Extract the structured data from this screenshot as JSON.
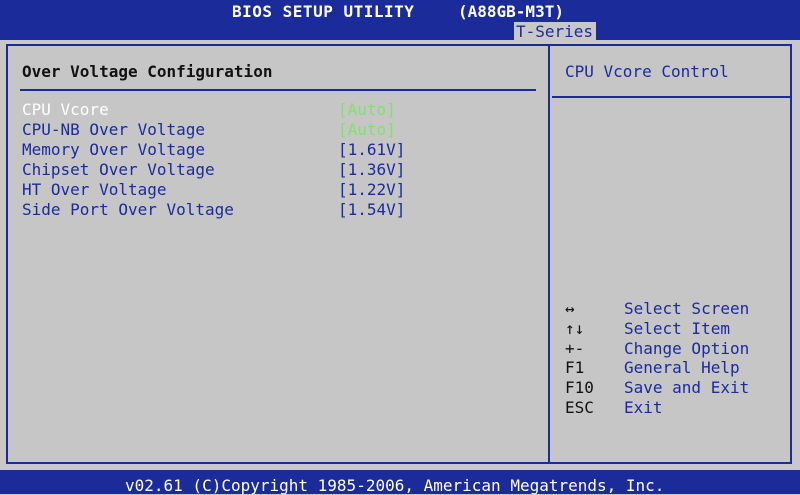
{
  "header": {
    "title": "BIOS SETUP UTILITY",
    "model": "(A88GB-M3T)",
    "tab": "T-Series"
  },
  "main": {
    "section_title": "Over Voltage Configuration",
    "items": [
      {
        "label": "CPU Vcore",
        "value": "[Auto]"
      },
      {
        "label": "CPU-NB Over Voltage",
        "value": "[Auto]"
      },
      {
        "label": "Memory Over Voltage",
        "value": "[1.61V]"
      },
      {
        "label": "Chipset Over Voltage",
        "value": "[1.36V]"
      },
      {
        "label": "HT Over Voltage",
        "value": "[1.22V]"
      },
      {
        "label": "Side Port Over Voltage",
        "value": "[1.54V]"
      }
    ]
  },
  "help": {
    "title": "CPU Vcore Control",
    "keys": [
      {
        "key": "↔",
        "desc": "Select Screen"
      },
      {
        "key": "↑↓",
        "desc": "Select Item"
      },
      {
        "key": "+-",
        "desc": "Change Option"
      },
      {
        "key": "F1",
        "desc": "General Help"
      },
      {
        "key": "F10",
        "desc": "Save and Exit"
      },
      {
        "key": "ESC",
        "desc": "Exit"
      }
    ]
  },
  "footer": {
    "text": "v02.61 (C)Copyright 1985-2006, American Megatrends, Inc."
  },
  "colors": {
    "bios_blue": "#1b2b9a",
    "background_gray": "#c8c8c8",
    "value_green": "#7fe36a",
    "selected_white": "#ffffff"
  }
}
